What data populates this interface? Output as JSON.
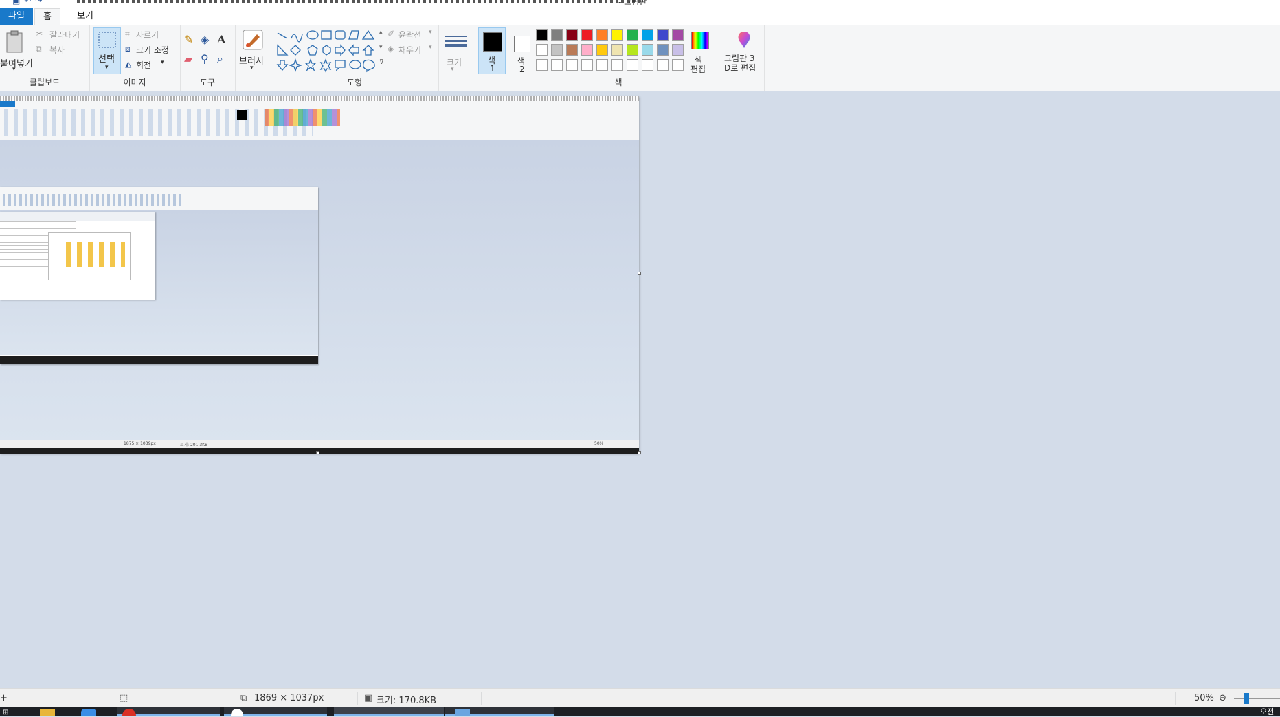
{
  "app": {
    "title": "- 그림판"
  },
  "tabs": [
    {
      "label": "파일",
      "active": false
    },
    {
      "label": "홈",
      "active": true
    },
    {
      "label": "보기",
      "active": false
    }
  ],
  "ribbon": {
    "clipboard": {
      "paste": "붙여넣기",
      "cut": "잘라내기",
      "copy": "복사",
      "label": "클립보드"
    },
    "image": {
      "select": "선택",
      "crop": "자르기",
      "resize": "크기 조정",
      "rotate": "회전",
      "label": "이미지"
    },
    "tools": {
      "label": "도구",
      "brush": "브러시"
    },
    "shapes": {
      "outline": "윤곽선",
      "fill": "채우기",
      "label": "도형"
    },
    "size": {
      "label": "크기"
    },
    "colors": {
      "color1_line1": "색",
      "color1_line2": "1",
      "color2_line1": "색",
      "color2_line2": "2",
      "edit_line1": "색",
      "edit_line2": "편집",
      "paint3d_line1": "그림판 3",
      "paint3d_line2": "D로 편집",
      "label": "색",
      "palette_row1": [
        "#000000",
        "#7f7f7f",
        "#880015",
        "#ed1c24",
        "#ff7f27",
        "#fff200",
        "#22b14c",
        "#00a2e8",
        "#3f48cc",
        "#a349a4"
      ],
      "palette_row2": [
        "#ffffff",
        "#c3c3c3",
        "#b97a57",
        "#ffaec9",
        "#ffc90e",
        "#efe4b0",
        "#b5e61d",
        "#99d9ea",
        "#7092be",
        "#c8bfe7"
      ],
      "palette_row3": [
        "#ffffff",
        "#ffffff",
        "#ffffff",
        "#ffffff",
        "#ffffff",
        "#ffffff",
        "#ffffff",
        "#ffffff",
        "#ffffff",
        "#ffffff"
      ]
    }
  },
  "nested": {
    "status_dimensions": "1875 × 1039px",
    "status_size": "크기: 201.3KB",
    "zoom": "50%"
  },
  "status": {
    "dimensions": "1869 × 1037px",
    "filesize": "크기: 170.8KB",
    "zoom": "50%"
  },
  "taskbar": {
    "clock": "오전"
  }
}
